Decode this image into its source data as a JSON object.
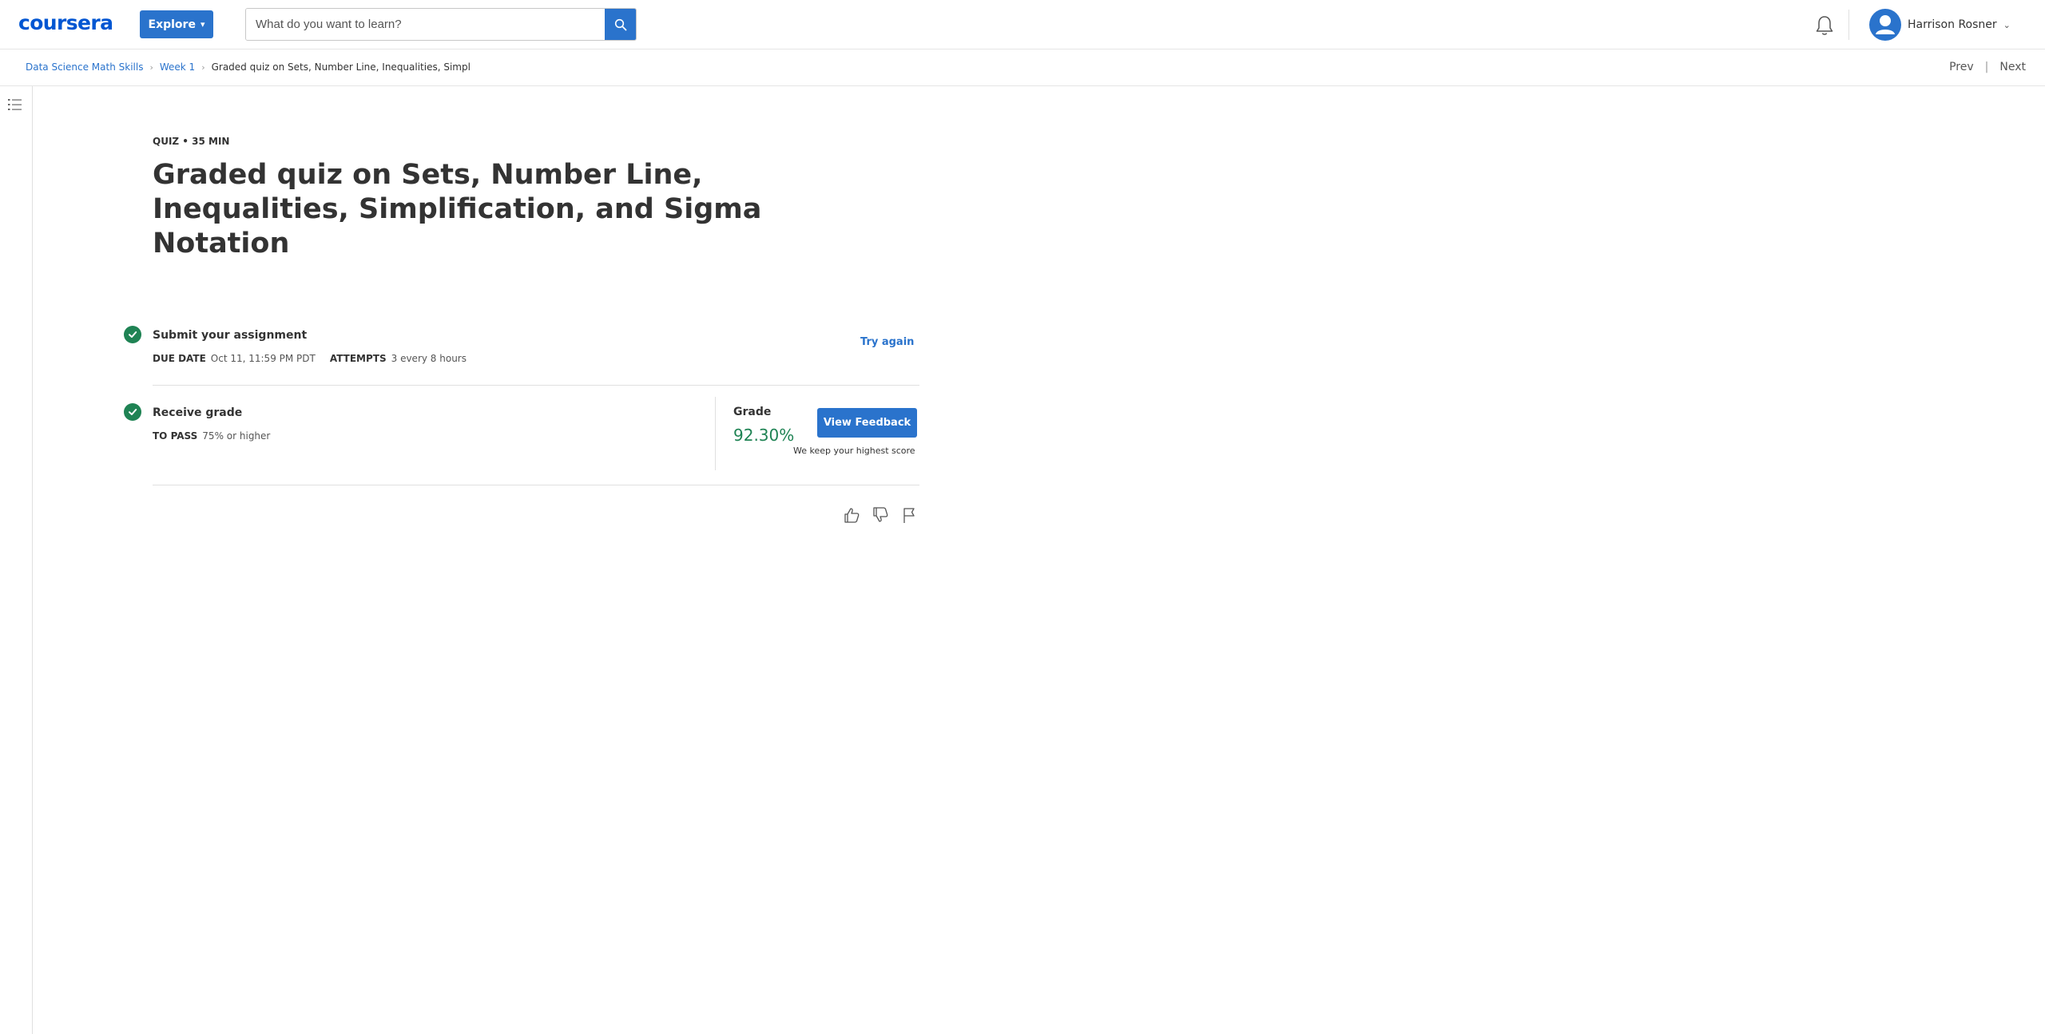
{
  "header": {
    "logo": "coursera",
    "explore_label": "Explore",
    "search_placeholder": "What do you want to learn?",
    "user_name": "Harrison Rosner",
    "icons": [
      "search-icon",
      "bell-icon",
      "avatar-icon",
      "chevron-down-icon"
    ],
    "accent": "#2a73cc"
  },
  "breadcrumb": {
    "course": "Data Science Math Skills",
    "week": "Week 1",
    "current": "Graded quiz on Sets, Number Line, Inequalities, Simpl"
  },
  "nav": {
    "prev": "Prev",
    "separator": "|",
    "next": "Next"
  },
  "quiz": {
    "kicker": "QUIZ • 35 MIN",
    "title": "Graded quiz on Sets, Number Line, Inequalities, Simplification, and Sigma Notation"
  },
  "submit": {
    "title": "Submit your assignment",
    "due_label": "DUE DATE",
    "due_value": "Oct 11, 11:59 PM PDT",
    "attempts_label": "ATTEMPTS",
    "attempts_value": "3 every 8 hours",
    "try_again": "Try again"
  },
  "receive": {
    "title": "Receive grade",
    "pass_label": "TO PASS",
    "pass_value": "75% or higher",
    "grade_label": "Grade",
    "grade_value": "92.30%",
    "view_feedback": "View Feedback",
    "note": "We keep your highest score"
  },
  "colors": {
    "success": "#1f8354",
    "link": "#2a73cc",
    "logo": "#0056d2"
  }
}
